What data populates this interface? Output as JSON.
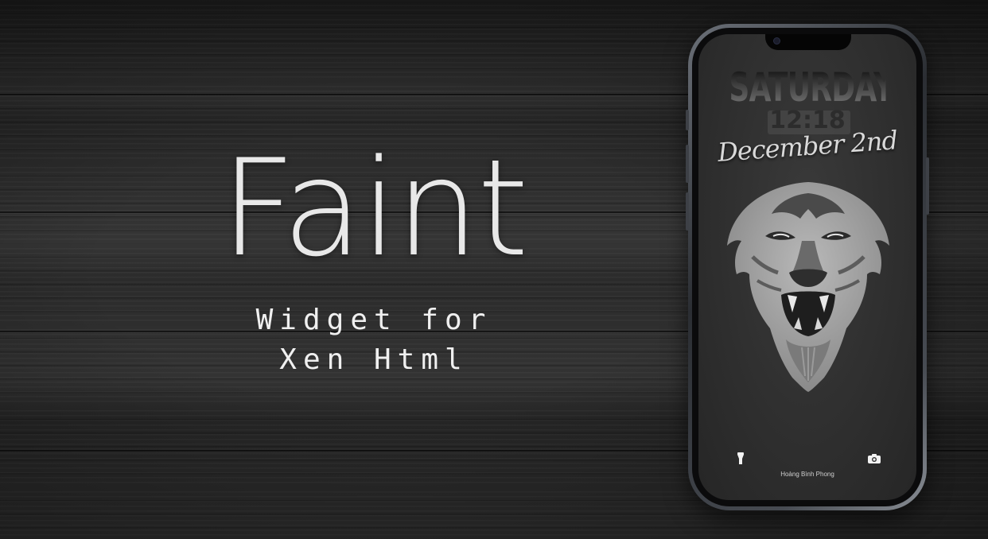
{
  "promo": {
    "title": "Faint",
    "subtitle_line1": "Widget for",
    "subtitle_line2": "Xen Html"
  },
  "lockscreen": {
    "day": "SATURDAY",
    "time": "12:18",
    "date": "December 2nd",
    "owner": "Hoàng Bình Phong",
    "flashlight_icon": "flashlight-icon",
    "camera_icon": "camera-icon",
    "wallpaper": "lion-face"
  },
  "colors": {
    "background": "#2d2d2d",
    "text": "#ececec",
    "screen": "#303030"
  }
}
